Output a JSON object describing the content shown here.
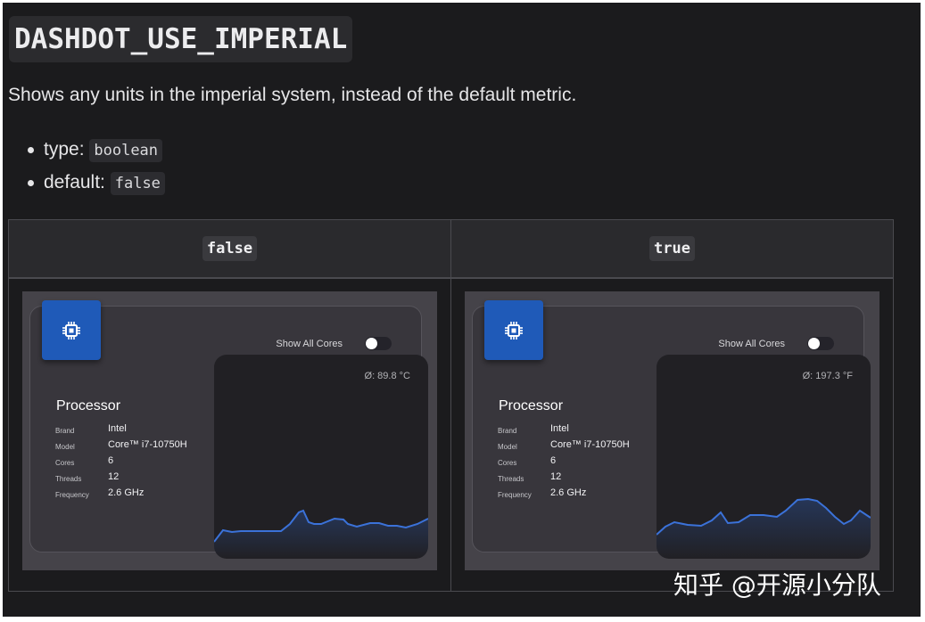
{
  "heading": "DASHDOT_USE_IMPERIAL",
  "description": "Shows any units in the imperial system, instead of the default metric.",
  "props": [
    {
      "label": "type:",
      "value": "boolean"
    },
    {
      "label": "default:",
      "value": "false"
    }
  ],
  "table": {
    "headers": [
      "false",
      "true"
    ]
  },
  "widgets": [
    {
      "icon": "cpu-chip-icon",
      "toggle_label": "Show All Cores",
      "toggle_on": false,
      "temperature": "Ø: 89.8 °C",
      "title": "Processor",
      "specs": [
        {
          "key": "Brand",
          "value": "Intel"
        },
        {
          "key": "Model",
          "value": "Core™ i7-10750H"
        },
        {
          "key": "Cores",
          "value": "6"
        },
        {
          "key": "Threads",
          "value": "12"
        },
        {
          "key": "Frequency",
          "value": "2.6 GHz"
        }
      ]
    },
    {
      "icon": "cpu-chip-icon",
      "toggle_label": "Show All Cores",
      "toggle_on": false,
      "temperature": "Ø: 197.3 °F",
      "title": "Processor",
      "specs": [
        {
          "key": "Brand",
          "value": "Intel"
        },
        {
          "key": "Model",
          "value": "Core™ i7-10750H"
        },
        {
          "key": "Cores",
          "value": "6"
        },
        {
          "key": "Threads",
          "value": "12"
        },
        {
          "key": "Frequency",
          "value": "2.6 GHz"
        }
      ]
    }
  ],
  "watermark": "知乎 @开源小分队",
  "colors": {
    "background": "#1b1b1d",
    "accent": "#1f5ab8",
    "graph_line": "#3b72d9"
  }
}
